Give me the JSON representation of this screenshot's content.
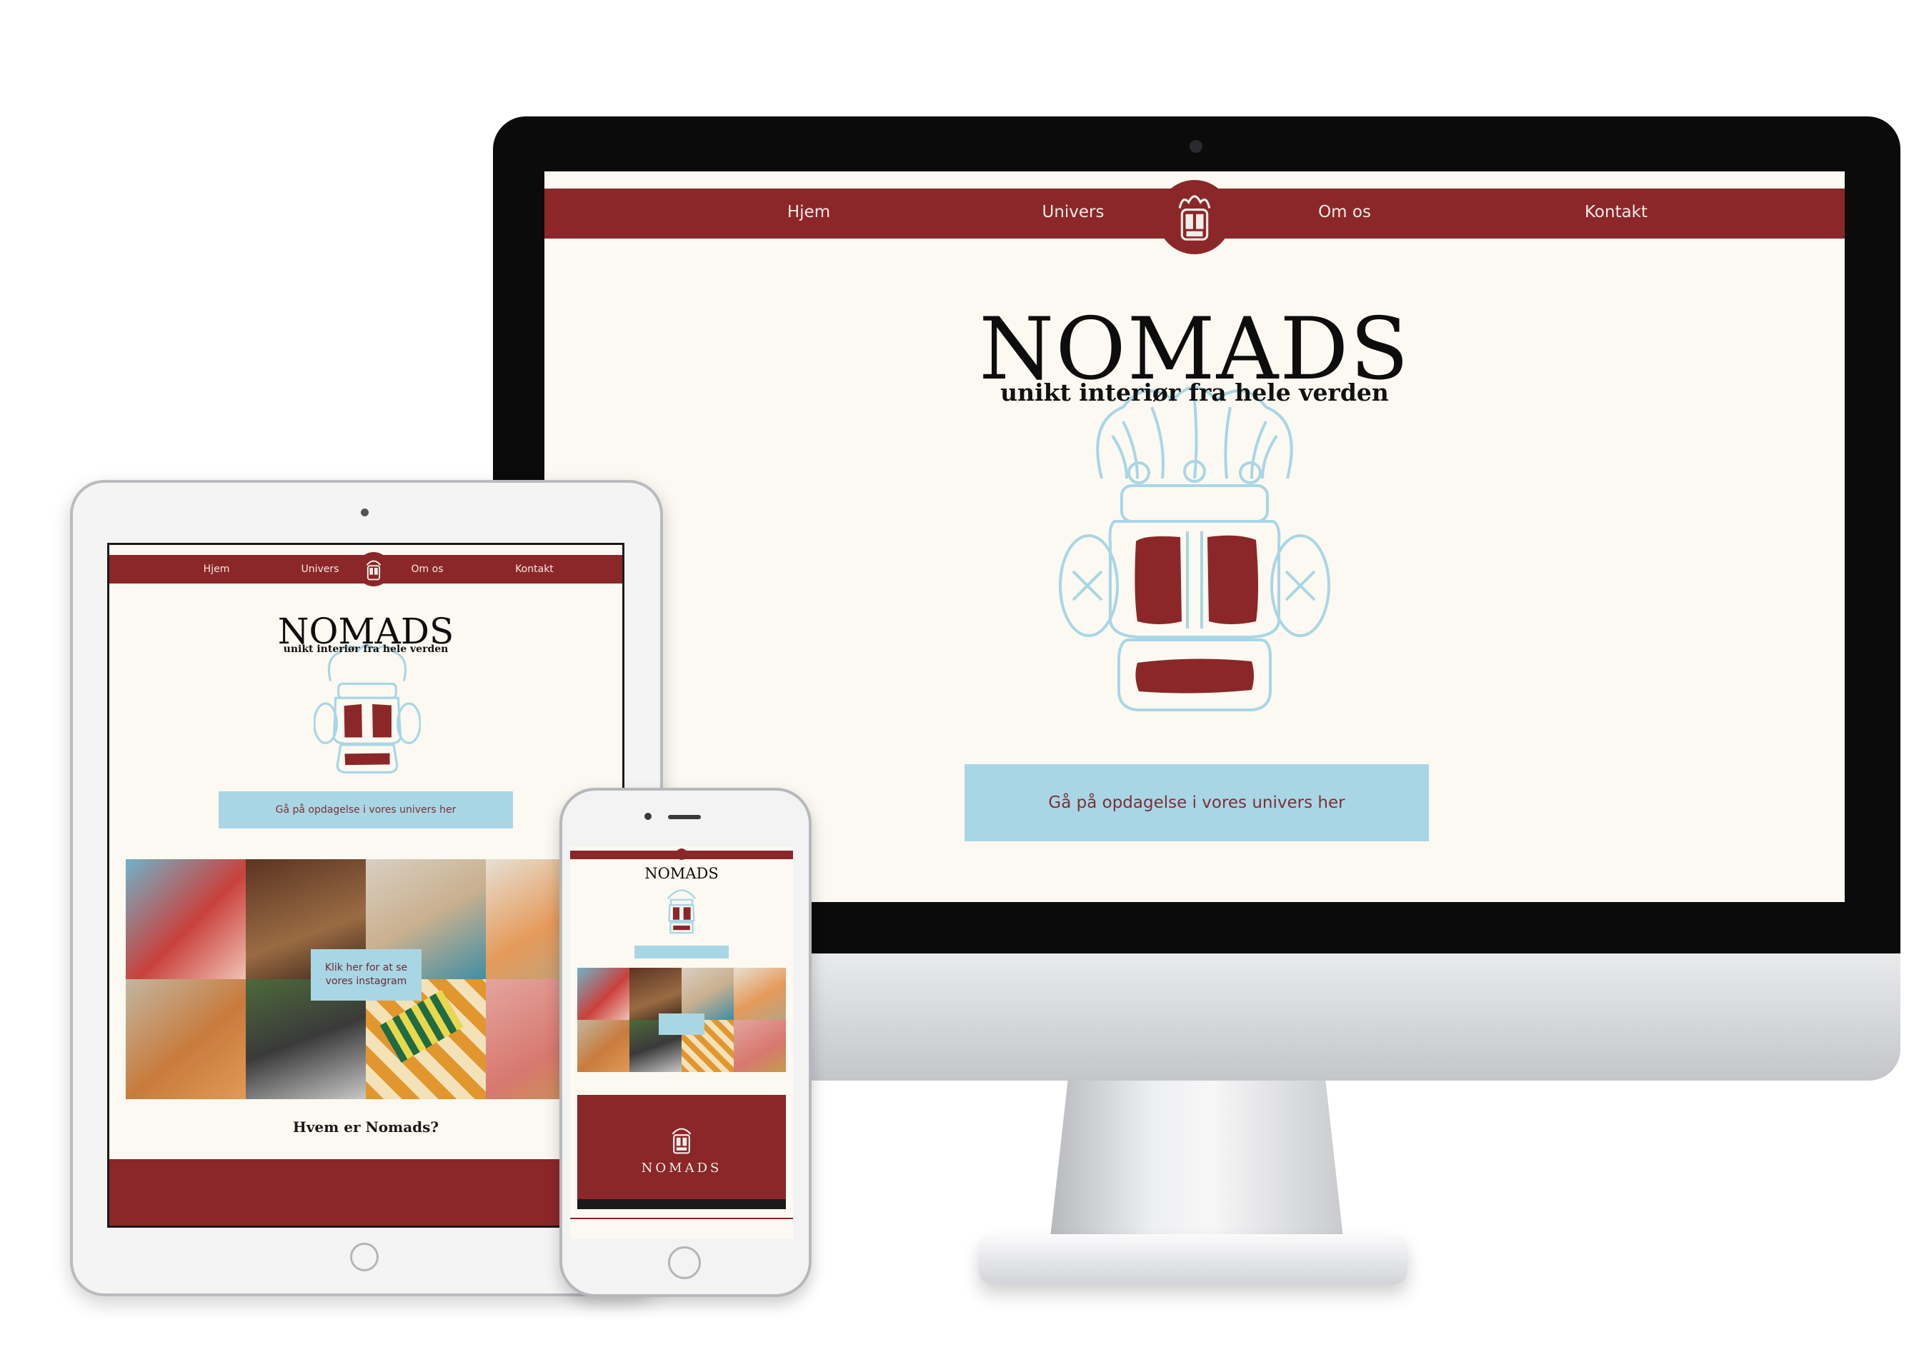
{
  "colors": {
    "brand_red": "#8b2728",
    "cream": "#fbf9f1",
    "sky_blue": "#a9d6e5",
    "text_dark": "#0d0d0d"
  },
  "nav": {
    "home": "Hjem",
    "universe": "Univers",
    "about": "Om os",
    "contact": "Kontakt"
  },
  "hero": {
    "brand": "NOMADS",
    "tagline": "unikt interiør fra hele verden",
    "cta": "Gå på opdagelse i vores univers her"
  },
  "instagram": {
    "label": "Klik her for at se vores instagram"
  },
  "section": {
    "who_heading": "Hvem er Nomads?"
  },
  "video": {
    "brand": "NOMADS"
  },
  "icons": {
    "logo": "tiki-mask-icon"
  }
}
